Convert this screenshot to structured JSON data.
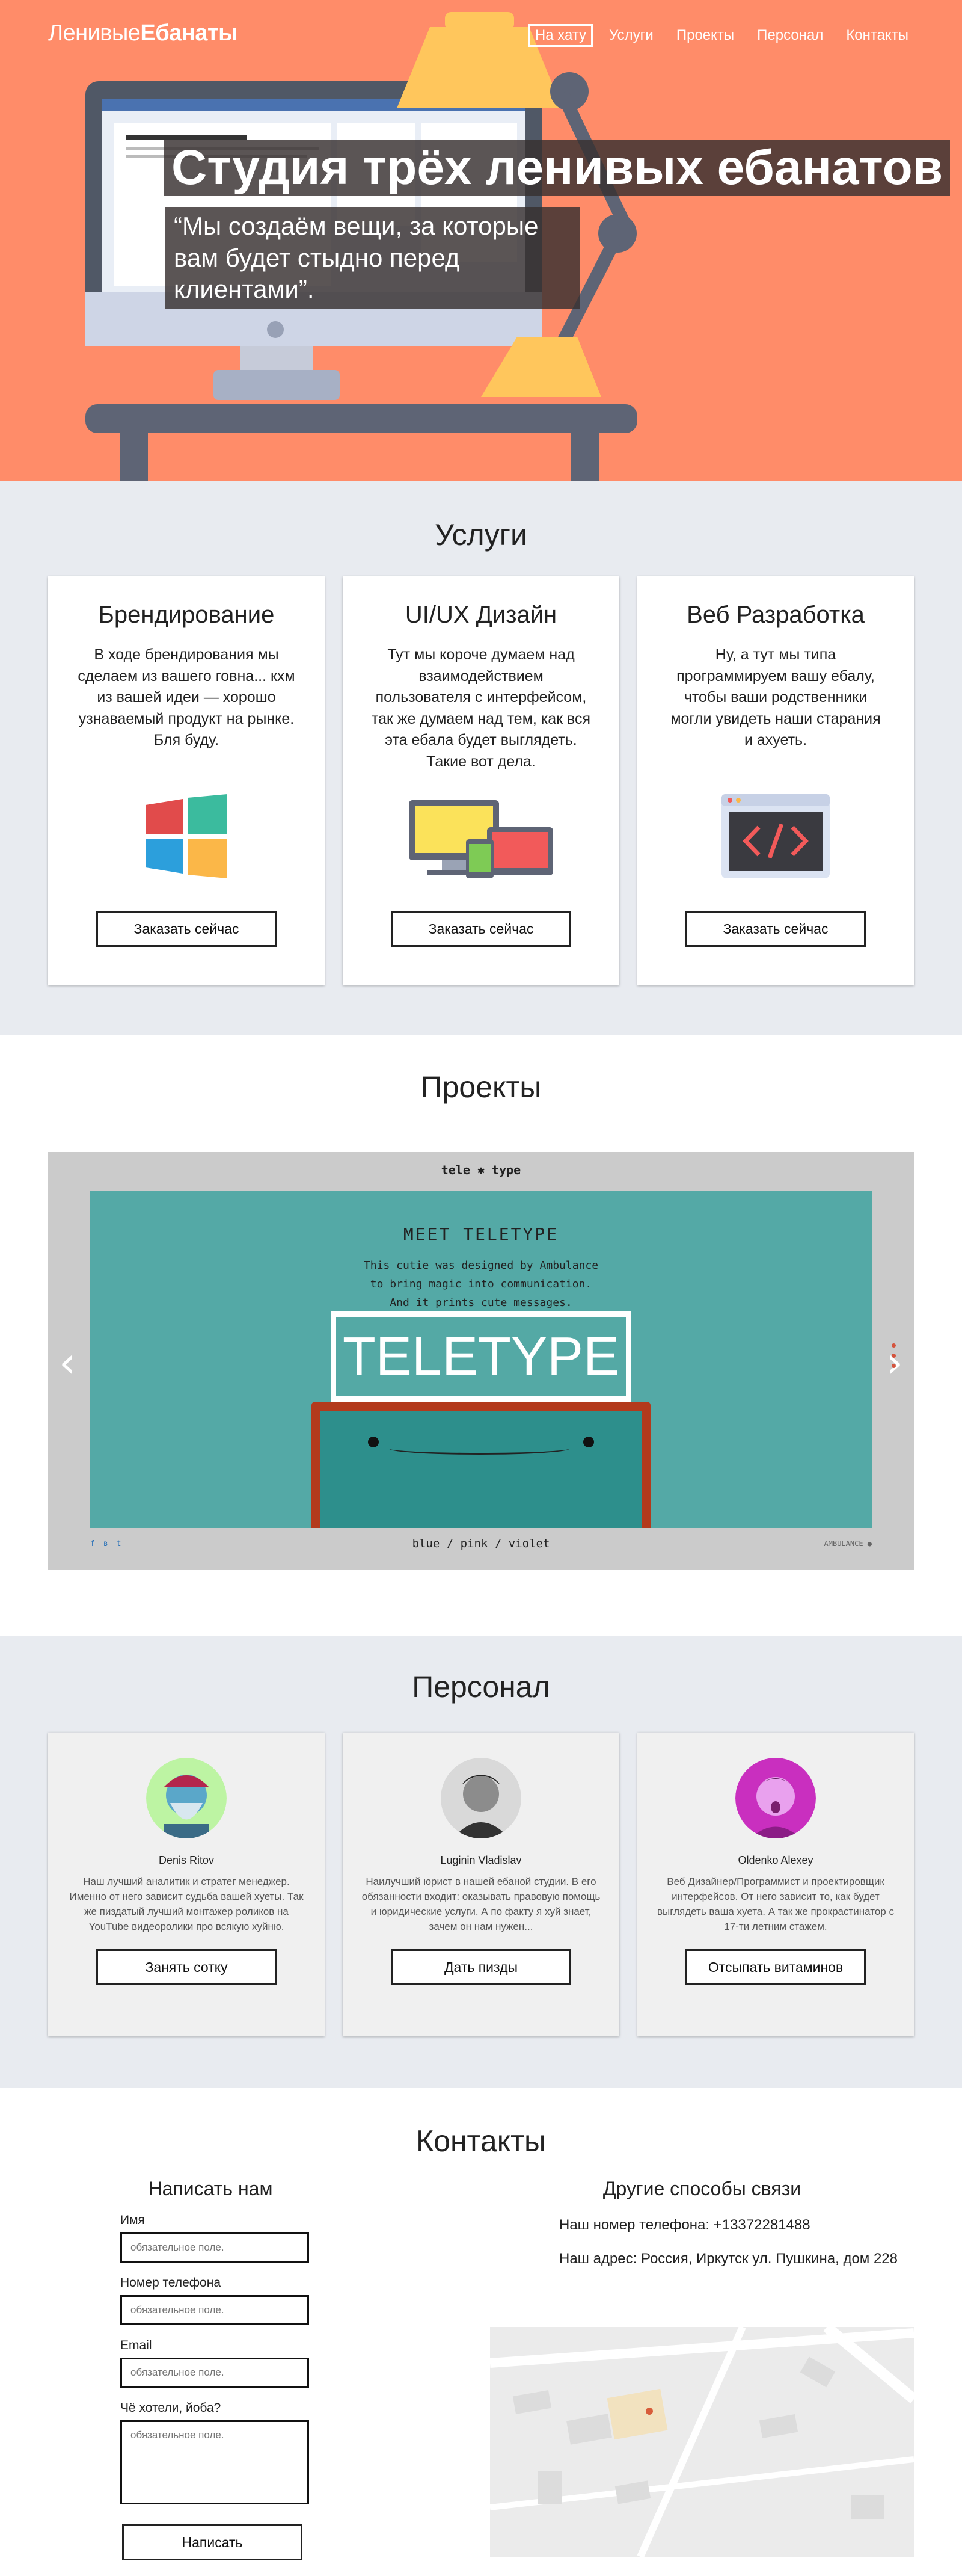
{
  "header": {
    "logo_light": "Ленивые",
    "logo_bold": "Ебанаты",
    "nav": [
      "На хату",
      "Услуги",
      "Проекты",
      "Персонал",
      "Контакты"
    ],
    "title": "Студия трёх ленивых ебанатов",
    "subtitle": "“Мы создаём вещи, за которые вам будет стыдно перед клиентами”."
  },
  "services": {
    "heading": "Услуги",
    "cards": [
      {
        "title": "Брендирование",
        "text": "В ходе брендирования мы сделаем из вашего говна... кхм из вашей идеи — хорошо узнаваемый продукт на рынке. Бля буду.",
        "icon": "windows-logo-icon",
        "button": "Заказать сейчас"
      },
      {
        "title": "UI/UX Дизайн",
        "text": "Тут мы короче думаем над взаимодействием пользователя с интерфейсом, так же думаем над тем, как вся эта ебала будет выглядеть. Такие вот дела.",
        "icon": "devices-icon",
        "button": "Заказать сейчас"
      },
      {
        "title": "Веб Разработка",
        "text": "Ну, а тут мы типа программируем вашу ебалу, чтобы ваши родственники могли увидеть наши старания и ахуеть.",
        "icon": "code-window-icon",
        "button": "Заказать сейчас"
      }
    ]
  },
  "projects": {
    "heading": "Проекты",
    "slide": {
      "logo": "tele ✱ type",
      "meet": "MEET TELETYPE",
      "desc": [
        "This cutie was designed by Ambulance",
        "to bring magic into communication.",
        "And it prints cute messages."
      ],
      "big": "TELETYPE",
      "social": [
        "f",
        "в",
        "t"
      ],
      "colors": "blue / pink / violet",
      "credit": "AMBULANCE ●"
    }
  },
  "staff": {
    "heading": "Персонал",
    "people": [
      {
        "name": "Denis Ritov",
        "text": "Наш лучший аналитик и стратег менеджер. Именно от него зависит судьба вашей хуеты. Так же пиздатый лучший монтажер роликов на YouTube видеоролики про всякую хуйню.",
        "button": "Занять сотку",
        "avatar_bg": "#bdf4a3"
      },
      {
        "name": "Luginin Vladislav",
        "text": "Наилучший юрист в нашей ебаной студии. В его обязанности входит: оказывать правовую помощь и юридические услуги. А по факту я хуй знает, зачем он нам нужен...",
        "button": "Дать пизды",
        "avatar_bg": "#dcdcdc"
      },
      {
        "name": "Oldenko Alexey",
        "text": "Веб Дизайнер/Программист и проектировщик интерфейсов. От него зависит то, как будет выглядеть ваша хуета. А так же прокрастинатор с 17-ти летним стажем.",
        "button": "Отсыпать витаминов",
        "avatar_bg": "#c92fbf"
      }
    ]
  },
  "contacts": {
    "heading": "Контакты",
    "form_title": "Написать нам",
    "fields": [
      {
        "label": "Имя",
        "placeholder": "обязательное поле."
      },
      {
        "label": "Номер телефона",
        "placeholder": "обязательное поле."
      },
      {
        "label": "Email",
        "placeholder": "обязательное поле."
      },
      {
        "label": "Чё хотели, йоба?",
        "placeholder": "обязательное поле."
      }
    ],
    "submit": "Написать",
    "other_title": "Другие способы связи",
    "phone": "Наш номер телефона: +13372281488",
    "address": "Наш адрес: Россия, Иркутск ул. Пушкина, дом 228"
  },
  "colors": {
    "hero": "#ff8c69",
    "grey_bg": "#e8ebf0",
    "teletype": "#54a9a6",
    "dot": "#d4543e"
  }
}
